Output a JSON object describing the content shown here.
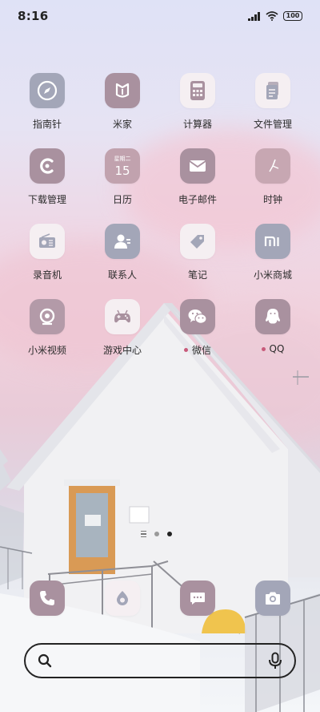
{
  "status_bar": {
    "time": "8:16",
    "battery": "100"
  },
  "apps": [
    {
      "label": "指南针"
    },
    {
      "label": "米家"
    },
    {
      "label": "计算器"
    },
    {
      "label": "文件管理"
    },
    {
      "label": "下载管理"
    },
    {
      "label": "日历",
      "calendar_day": "15",
      "calendar_weekday": "星期二"
    },
    {
      "label": "电子邮件"
    },
    {
      "label": "时钟"
    },
    {
      "label": "录音机"
    },
    {
      "label": "联系人"
    },
    {
      "label": "笔记"
    },
    {
      "label": "小米商城"
    },
    {
      "label": "小米视频"
    },
    {
      "label": "游戏中心"
    },
    {
      "label": "微信",
      "new_badge": true
    },
    {
      "label": "QQ",
      "new_badge": true
    }
  ],
  "page_indicator": {
    "pages": 2,
    "current": 2
  },
  "dock": [
    "phone-icon",
    "browser-icon",
    "messages-icon",
    "camera-icon"
  ],
  "colors": {
    "icon_mauve": "#a9919f",
    "icon_grey": "#a3a6b8",
    "icon_white": "#f5eff2",
    "text": "#2c2c2c"
  }
}
